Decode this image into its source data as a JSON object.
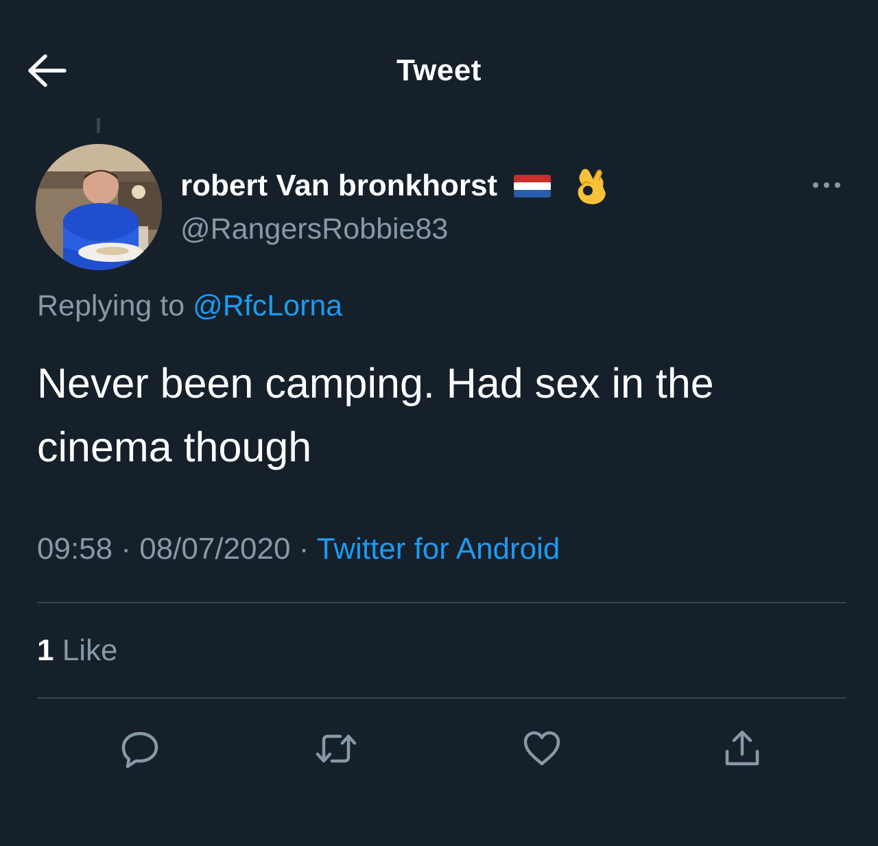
{
  "header": {
    "title": "Tweet",
    "back_icon": "back-arrow-icon"
  },
  "tweet": {
    "author": {
      "display_name": "robert Van bronkhorst",
      "handle": "@RangersRobbie83",
      "name_emojis": [
        "flag-netherlands",
        "ok-hand"
      ]
    },
    "replying_to": {
      "prefix": "Replying to",
      "mention": "@RfcLorna"
    },
    "text": "Never been camping. Had sex in the cinema though",
    "time": "09:58",
    "date": "08/07/2020",
    "separator": "·",
    "source": "Twitter for Android",
    "likes": {
      "count": "1",
      "label": "Like"
    }
  },
  "actions": [
    {
      "name": "reply",
      "icon": "reply-icon"
    },
    {
      "name": "retweet",
      "icon": "retweet-icon"
    },
    {
      "name": "like",
      "icon": "heart-icon"
    },
    {
      "name": "share",
      "icon": "share-icon"
    }
  ],
  "colors": {
    "background": "#15202b",
    "text_primary": "#ffffff",
    "text_secondary": "#8899a6",
    "accent": "#1d9bf0",
    "divider": "#38444d"
  }
}
